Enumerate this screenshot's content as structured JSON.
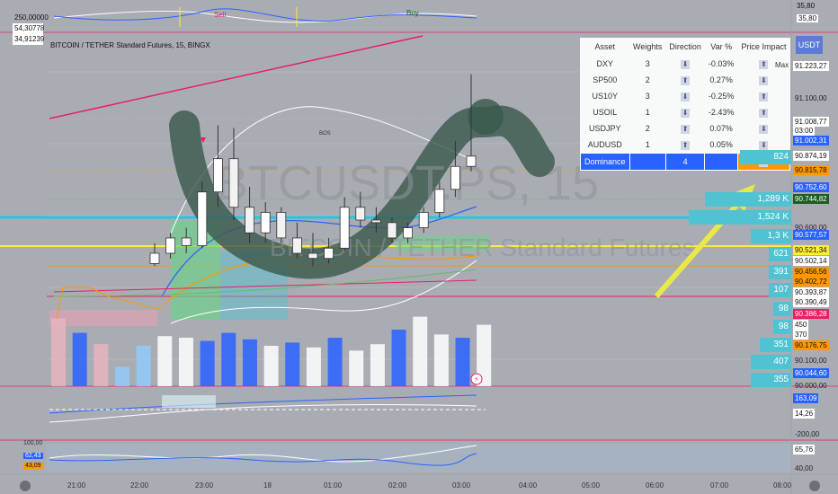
{
  "chart_title": "BITCOIN / TETHER Standard Futures, 15, BINGX",
  "watermark_top": "BTCUSDT.PS, 15",
  "watermark_sub": "BITCOIN / TETHER Standard Futures",
  "bos_label": "BOS",
  "sell_label": "Sell",
  "buy_label": "Buy",
  "osc_values": [
    "250,00000",
    "54,30778",
    "34,91239"
  ],
  "osc_right": [
    "35,80",
    "35,80"
  ],
  "currency": "USDT",
  "max_label": "Max",
  "table": {
    "headers": [
      "Asset",
      "Weights",
      "Direction",
      "Var %",
      "Price Impact"
    ],
    "rows": [
      {
        "asset": "DXY",
        "weight": "3",
        "direction": "⬇",
        "var": "-0.03%",
        "impact": "⬆"
      },
      {
        "asset": "SP500",
        "weight": "2",
        "direction": "⬆",
        "var": "0.27%",
        "impact": "⬇"
      },
      {
        "asset": "US10Y",
        "weight": "3",
        "direction": "⬇",
        "var": "-0.25%",
        "impact": "⬆"
      },
      {
        "asset": "USOIL",
        "weight": "1",
        "direction": "⬇",
        "var": "-2.43%",
        "impact": "⬆"
      },
      {
        "asset": "USDJPY",
        "weight": "2",
        "direction": "⬆",
        "var": "0.07%",
        "impact": "⬇"
      },
      {
        "asset": "AUDUSD",
        "weight": "1",
        "direction": "⬆",
        "var": "0.05%",
        "impact": "⬇"
      }
    ],
    "dominance": {
      "label": "Dominance",
      "value": "4",
      "impact": "⬆"
    }
  },
  "price_scale": [
    {
      "text": "91.223,27",
      "bg": "#ffffff",
      "fg": "#111111"
    },
    {
      "text": "91.100,00",
      "bg": "",
      "fg": "#222222"
    },
    {
      "text": "91.008,77",
      "bg": "#ffffff",
      "fg": "#111111"
    },
    {
      "text": "03:00",
      "bg": "#ffffff",
      "fg": "#111111"
    },
    {
      "text": "91.002,31",
      "bg": "#2962ff",
      "fg": "#ffffff"
    },
    {
      "text": "90.874,19",
      "bg": "#ffffff",
      "fg": "#111111"
    },
    {
      "text": "90.815,78",
      "bg": "#ff9800",
      "fg": "#111111"
    },
    {
      "text": "90.752,60",
      "bg": "#2962ff",
      "fg": "#ffffff"
    },
    {
      "text": "90.744,82",
      "bg": "#1b5e20",
      "fg": "#ffffff"
    },
    {
      "text": "90.600,00",
      "bg": "",
      "fg": "#222222"
    },
    {
      "text": "90.577,57",
      "bg": "#2962ff",
      "fg": "#ffffff"
    },
    {
      "text": "90.521,34",
      "bg": "#ffeb3b",
      "fg": "#111111"
    },
    {
      "text": "90.502,14",
      "bg": "#ffffff",
      "fg": "#111111"
    },
    {
      "text": "90.456,56",
      "bg": "#ff9800",
      "fg": "#111111"
    },
    {
      "text": "90.402,72",
      "bg": "#ff9800",
      "fg": "#111111"
    },
    {
      "text": "90.393,87",
      "bg": "#ffffff",
      "fg": "#111111"
    },
    {
      "text": "90.390,49",
      "bg": "#ffffff",
      "fg": "#111111"
    },
    {
      "text": "90.386,28",
      "bg": "#e91e63",
      "fg": "#ffffff"
    },
    {
      "text": "450",
      "bg": "#ffffff",
      "fg": "#111111"
    },
    {
      "text": "370",
      "bg": "#ffffff",
      "fg": "#111111"
    },
    {
      "text": "90.176,75",
      "bg": "#ff9800",
      "fg": "#111111"
    },
    {
      "text": "90.100,00",
      "bg": "",
      "fg": "#222222"
    },
    {
      "text": "90.044,60",
      "bg": "#2962ff",
      "fg": "#ffffff"
    },
    {
      "text": "90.000,00",
      "bg": "",
      "fg": "#222222"
    },
    {
      "text": "163,09",
      "bg": "#2962ff",
      "fg": "#ffffff"
    },
    {
      "text": "14,26",
      "bg": "#ffffff",
      "fg": "#111111"
    },
    {
      "text": "-200,00",
      "bg": "",
      "fg": "#222222"
    },
    {
      "text": "65,76",
      "bg": "#ffffff",
      "fg": "#111111"
    },
    {
      "text": "40,00",
      "bg": "",
      "fg": "#222222"
    }
  ],
  "volume_profile": [
    "824",
    "1,289 K",
    "1,524 K",
    "1,3 K",
    "621",
    "391",
    "107",
    "98",
    "98",
    "351",
    "407",
    "355"
  ],
  "left_osc": [
    "100,00",
    "62,43",
    "43,09"
  ],
  "x_axis": [
    "21:00",
    "22:00",
    "23:00",
    "18",
    "01:00",
    "02:00",
    "03:00",
    "04:00",
    "05:00",
    "06:00",
    "07:00",
    "08:00"
  ],
  "candles": [
    {
      "o": 90480,
      "h": 90560,
      "l": 90470,
      "c": 90520
    },
    {
      "o": 90520,
      "h": 90600,
      "l": 90500,
      "c": 90580
    },
    {
      "o": 90580,
      "h": 90620,
      "l": 90520,
      "c": 90550
    },
    {
      "o": 90550,
      "h": 90800,
      "l": 90540,
      "c": 90760
    },
    {
      "o": 90760,
      "h": 91020,
      "l": 90700,
      "c": 90890
    },
    {
      "o": 90890,
      "h": 91010,
      "l": 90650,
      "c": 90700
    },
    {
      "o": 90700,
      "h": 90780,
      "l": 90560,
      "c": 90600
    },
    {
      "o": 90600,
      "h": 90720,
      "l": 90560,
      "c": 90680
    },
    {
      "o": 90680,
      "h": 90700,
      "l": 90560,
      "c": 90580
    },
    {
      "o": 90580,
      "h": 90640,
      "l": 90500,
      "c": 90520
    },
    {
      "o": 90520,
      "h": 90600,
      "l": 90470,
      "c": 90500
    },
    {
      "o": 90500,
      "h": 90580,
      "l": 90480,
      "c": 90540
    },
    {
      "o": 90540,
      "h": 90740,
      "l": 90530,
      "c": 90700
    },
    {
      "o": 90700,
      "h": 90760,
      "l": 90620,
      "c": 90650
    },
    {
      "o": 90650,
      "h": 90700,
      "l": 90600,
      "c": 90640
    },
    {
      "o": 90640,
      "h": 90660,
      "l": 90560,
      "c": 90580
    },
    {
      "o": 90580,
      "h": 90640,
      "l": 90560,
      "c": 90620
    },
    {
      "o": 90620,
      "h": 90700,
      "l": 90600,
      "c": 90680
    },
    {
      "o": 90680,
      "h": 90800,
      "l": 90660,
      "c": 90770
    },
    {
      "o": 90770,
      "h": 90960,
      "l": 90740,
      "c": 90860
    },
    {
      "o": 90860,
      "h": 91220,
      "l": 90840,
      "c": 90900
    }
  ],
  "volumes": [
    420,
    330,
    260,
    120,
    250,
    310,
    300,
    280,
    330,
    290,
    250,
    270,
    240,
    300,
    220,
    260,
    350,
    430,
    320,
    300,
    380
  ],
  "colors": {
    "bull": "#ffffff",
    "bear": "#f2f2f2",
    "accent": "#2962ff",
    "teal": "#4fc3d1"
  }
}
